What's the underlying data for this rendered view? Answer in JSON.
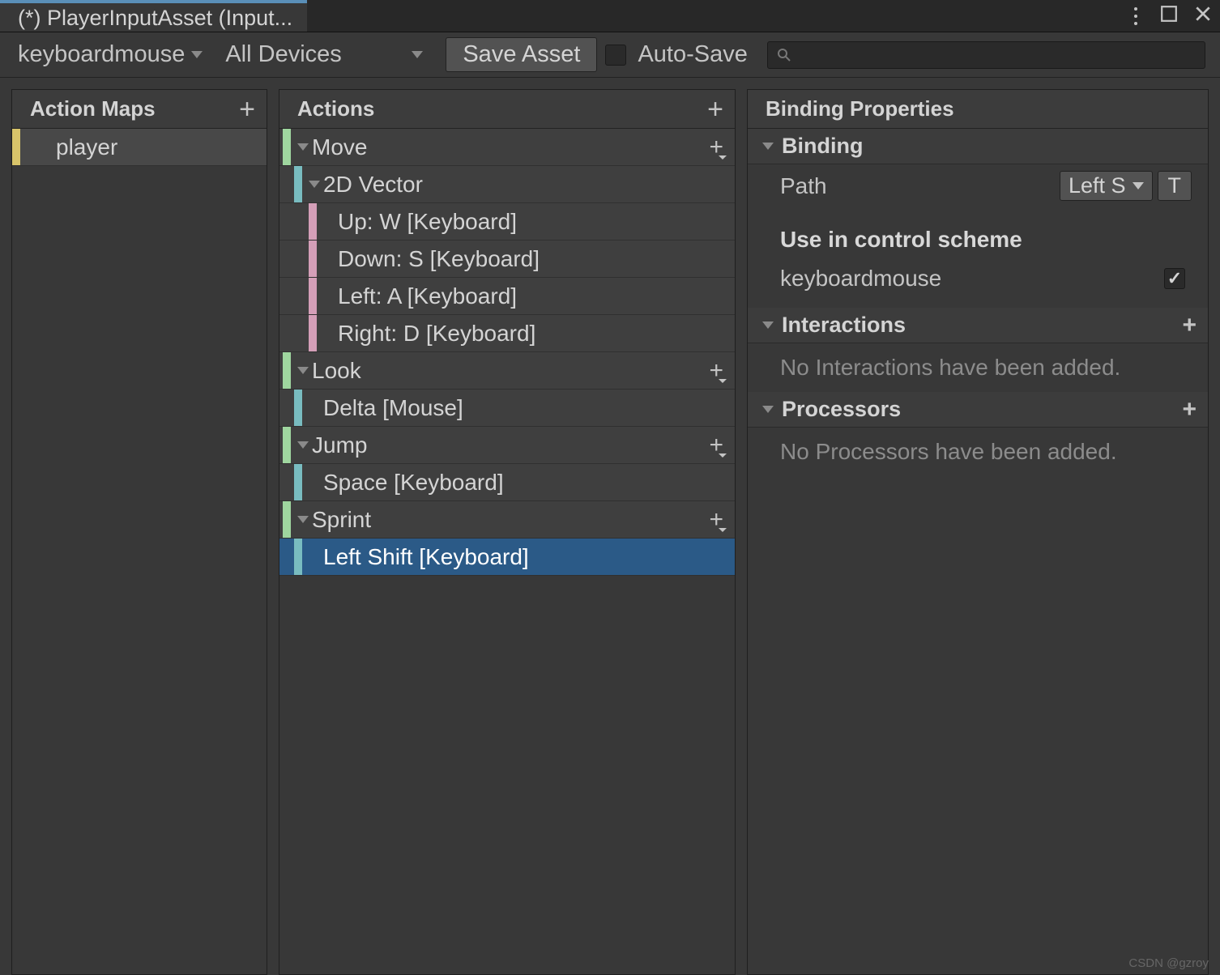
{
  "tab_title": "(*) PlayerInputAsset (Input...",
  "toolbar": {
    "scheme": "keyboardmouse",
    "devices": "All Devices",
    "save_label": "Save Asset",
    "autosave_label": "Auto-Save",
    "autosave_checked": false
  },
  "panels": {
    "action_maps_header": "Action Maps",
    "actions_header": "Actions",
    "binding_props_header": "Binding Properties"
  },
  "action_maps": [
    {
      "name": "player",
      "selected": true
    }
  ],
  "actions": {
    "move": {
      "label": "Move"
    },
    "vector2d": {
      "label": "2D Vector"
    },
    "up": {
      "label": "Up: W [Keyboard]"
    },
    "down": {
      "label": "Down: S [Keyboard]"
    },
    "left": {
      "label": "Left: A [Keyboard]"
    },
    "right": {
      "label": "Right: D [Keyboard]"
    },
    "look": {
      "label": "Look"
    },
    "delta": {
      "label": "Delta [Mouse]"
    },
    "jump": {
      "label": "Jump"
    },
    "space": {
      "label": "Space [Keyboard]"
    },
    "sprint": {
      "label": "Sprint"
    },
    "leftshift": {
      "label": "Left Shift [Keyboard]"
    }
  },
  "props": {
    "binding_section": "Binding",
    "path_label": "Path",
    "path_value": "Left S",
    "t_label": "T",
    "use_scheme_label": "Use in control scheme",
    "scheme_name": "keyboardmouse",
    "scheme_checked": true,
    "interactions_section": "Interactions",
    "interactions_empty": "No Interactions have been added.",
    "processors_section": "Processors",
    "processors_empty": "No Processors have been added."
  },
  "watermark": "CSDN @gzroy"
}
